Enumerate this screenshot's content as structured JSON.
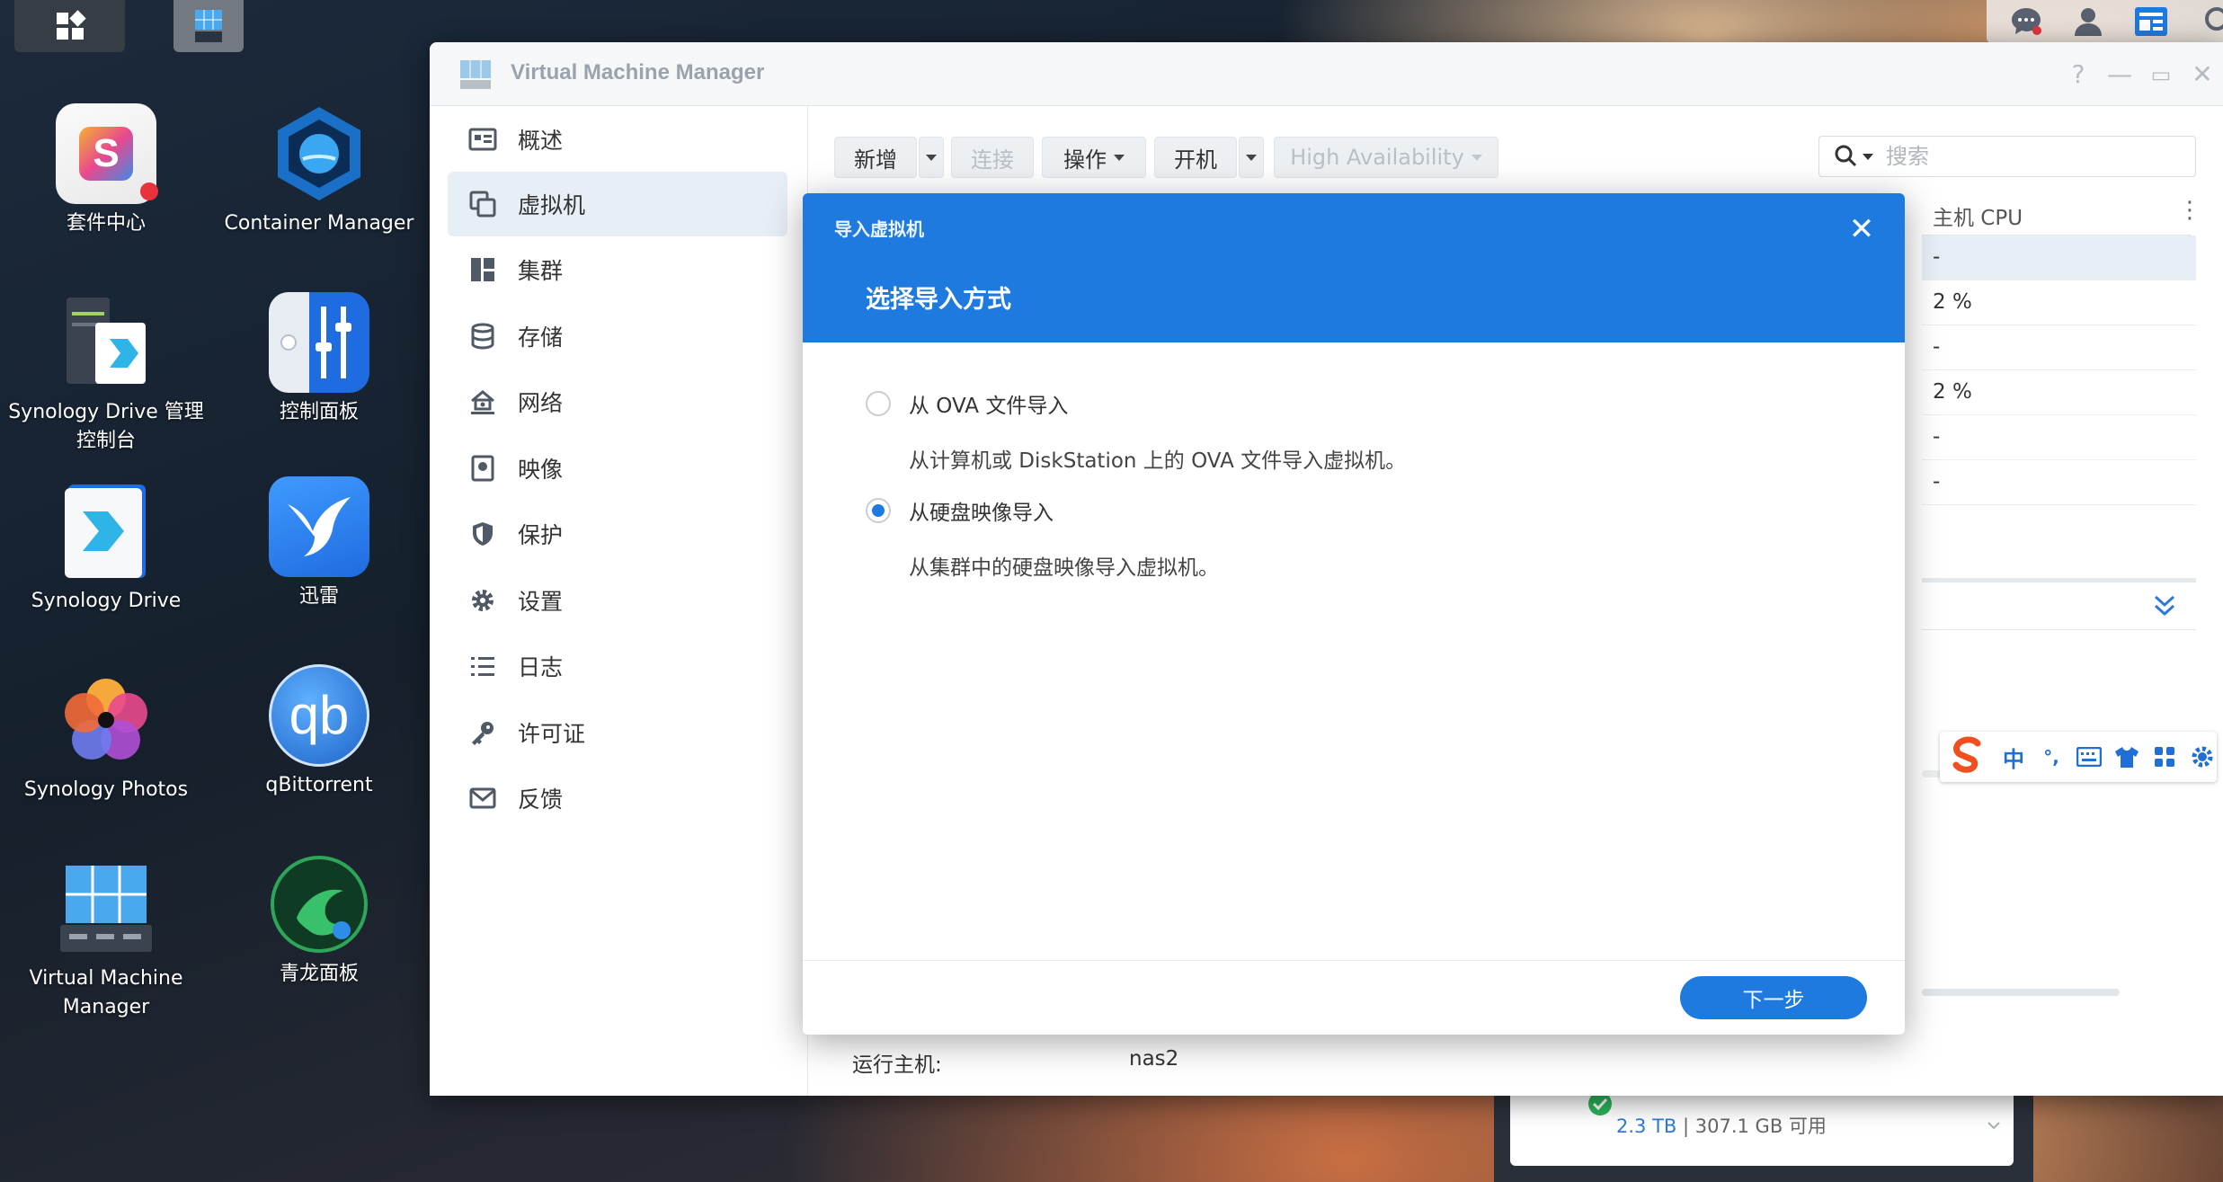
{
  "desktop": {
    "icons": [
      {
        "label": "套件中心"
      },
      {
        "label": "Container Manager"
      },
      {
        "label": "Synology Drive 管理控制台"
      },
      {
        "label": "控制面板"
      },
      {
        "label": "Synology Drive"
      },
      {
        "label": "迅雷"
      },
      {
        "label": "Synology Photos"
      },
      {
        "label": "qBittorrent",
        "glyph": "qb"
      },
      {
        "label": "Virtual Machine Manager"
      },
      {
        "label": "青龙面板"
      }
    ]
  },
  "window": {
    "title": "Virtual Machine Manager",
    "controls": {
      "help": "?",
      "minimize": "—",
      "maximize": "▭",
      "close": "✕"
    }
  },
  "sidebar": {
    "items": [
      {
        "label": "概述",
        "icon": "overview-icon"
      },
      {
        "label": "虚拟机",
        "icon": "vm-icon",
        "active": true
      },
      {
        "label": "集群",
        "icon": "cluster-icon"
      },
      {
        "label": "存储",
        "icon": "storage-icon"
      },
      {
        "label": "网络",
        "icon": "network-icon"
      },
      {
        "label": "映像",
        "icon": "image-icon"
      },
      {
        "label": "保护",
        "icon": "shield-icon"
      },
      {
        "label": "设置",
        "icon": "gear-icon"
      },
      {
        "label": "日志",
        "icon": "list-icon"
      },
      {
        "label": "许可证",
        "icon": "key-icon"
      },
      {
        "label": "反馈",
        "icon": "mail-icon"
      }
    ]
  },
  "toolbar": {
    "add": "新增",
    "connect": "连接",
    "action": "操作",
    "power_on": "开机",
    "ha": "High Availability"
  },
  "search": {
    "placeholder": "搜索"
  },
  "table": {
    "column": "主机 CPU",
    "rows": [
      "-",
      "2 %",
      "-",
      "2 %",
      "-",
      "-"
    ]
  },
  "details": {
    "host_label": "运行主机:",
    "host_value": "nas2"
  },
  "storage_widget": {
    "total": "2.3 TB",
    "separator": "|",
    "free": "307.1 GB 可用"
  },
  "ime": {
    "mode": "中",
    "punct": "°,"
  },
  "dialog": {
    "small_title": "导入虚拟机",
    "title": "选择导入方式",
    "options": [
      {
        "label": "从 OVA 文件导入",
        "desc": "从计算机或 DiskStation 上的 OVA 文件导入虚拟机。",
        "selected": false
      },
      {
        "label": "从硬盘映像导入",
        "desc": "从集群中的硬盘映像导入虚拟机。",
        "selected": true
      }
    ],
    "next": "下一步",
    "close": "✕"
  },
  "colors": {
    "accent": "#1f7ae0",
    "sidebar_active": "#e8eef6"
  }
}
